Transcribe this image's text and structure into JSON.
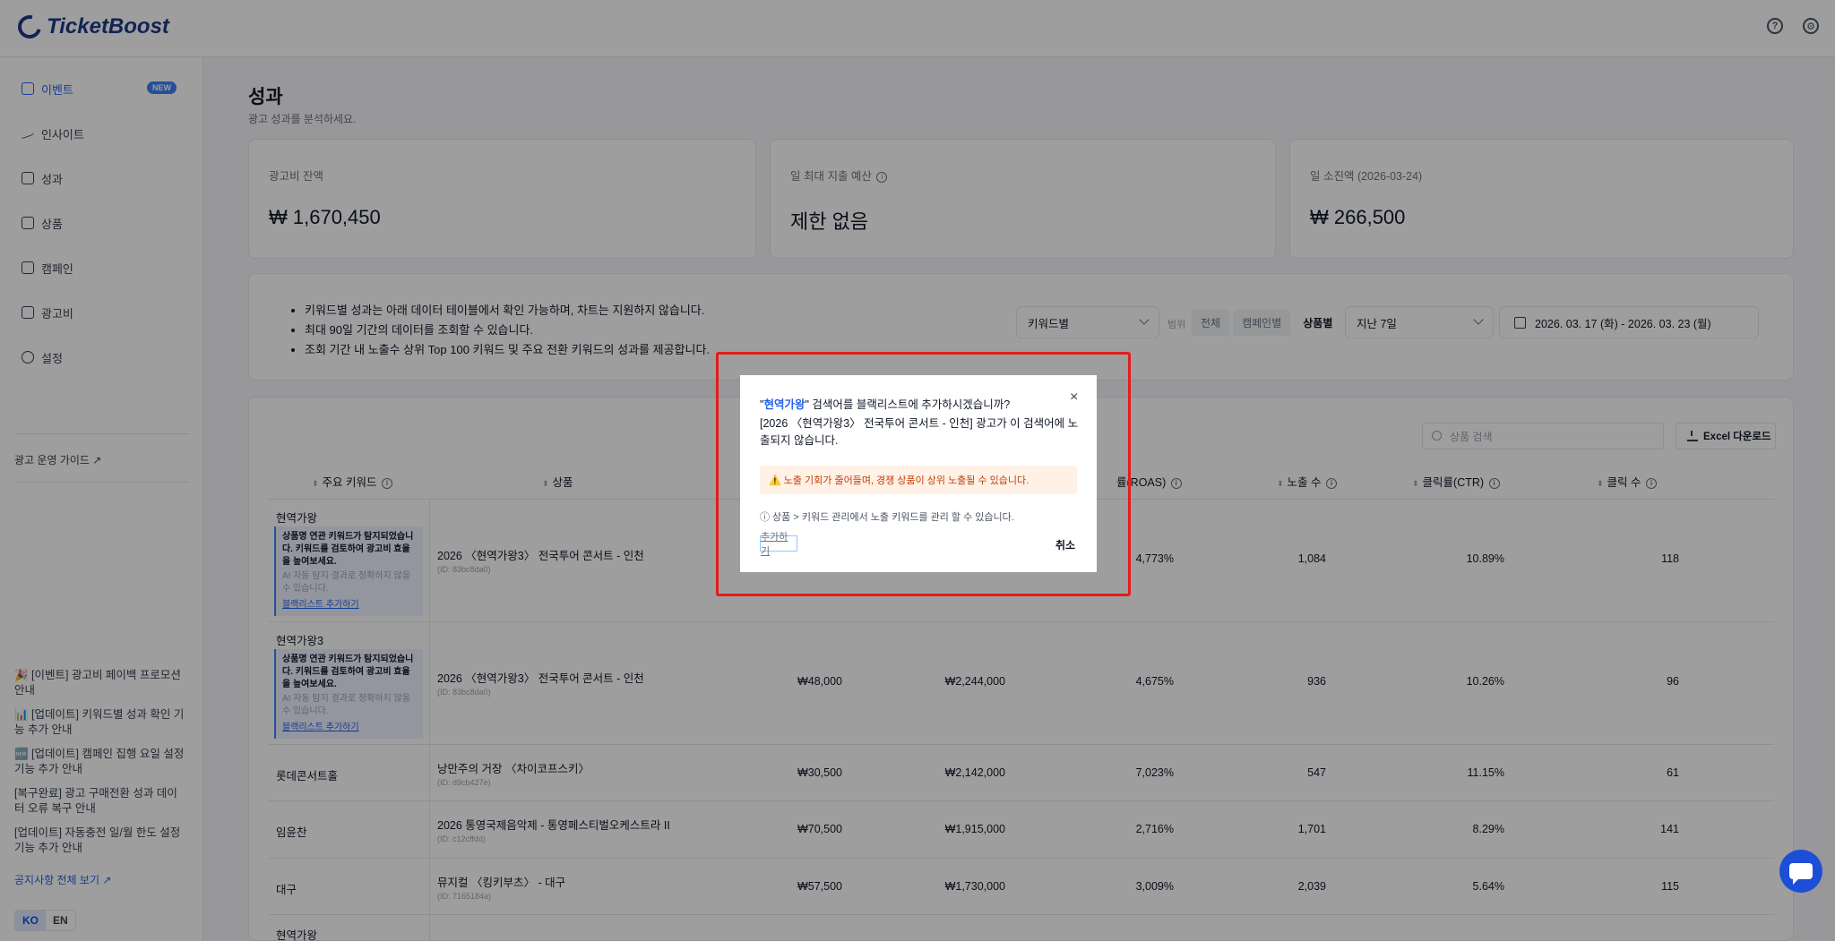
{
  "app": {
    "logo_text": "TicketBoost"
  },
  "sidebar": {
    "items": [
      {
        "label": "이벤트",
        "icon": "gift-icon",
        "badge": "NEW"
      },
      {
        "label": "인사이트",
        "icon": "activity-icon"
      },
      {
        "label": "성과",
        "icon": "bar-chart-icon"
      },
      {
        "label": "상품",
        "icon": "box-icon"
      },
      {
        "label": "캠페인",
        "icon": "grid-icon"
      },
      {
        "label": "광고비",
        "icon": "credit-card-icon"
      },
      {
        "label": "설정",
        "icon": "gear-icon"
      }
    ],
    "guide_link": "광고 운영 가이드 ↗",
    "notices": [
      "🎉 [이벤트] 광고비 페이백 프로모션 안내",
      "📊 [업데이트] 키워드별 성과 확인 기능 추가 안내",
      "🆕 [업데이트] 캠페인 집행 요일 설정 기능 추가 안내",
      "[복구완료] 광고 구매전환 성과 데이터 오류 복구 안내",
      "[업데이트] 자동충전 일/월 한도 설정 기능 추가 안내"
    ],
    "all_notices": "공지사항 전체 보기 ↗",
    "lang": {
      "ko": "KO",
      "en": "EN"
    }
  },
  "page": {
    "title": "성과",
    "subtitle": "광고 성과를 분석하세요."
  },
  "cards": [
    {
      "label": "광고비 잔액",
      "value": "₩ 1,670,450",
      "info": ""
    },
    {
      "label": "일 최대 지출 예산",
      "value": "제한 없음",
      "info": "i"
    },
    {
      "label": "일 소진액 (2026-03-24)",
      "value": "₩ 266,500",
      "info": ""
    }
  ],
  "filters": {
    "bullets": [
      "키워드별 성과는 아래 데이터 테이블에서 확인 가능하며, 차트는 지원하지 않습니다.",
      "최대 90일 기간의 데이터를 조회할 수 있습니다.",
      "조회 기간 내 노출수 상위 Top 100 키워드 및 주요 전환 키워드의 성과를 제공합니다."
    ],
    "view_select": "키워드별",
    "range_label": "범위",
    "segments": [
      "전체",
      "캠페인별",
      "상품별"
    ],
    "period_select": "지난 7일",
    "date_range": "2026. 03. 17 (화) - 2026. 03. 23 (월)"
  },
  "table": {
    "search_placeholder": "상품 검색",
    "excel_label": "Excel 다운로드",
    "headers": {
      "keyword": "주요 키워드",
      "product": "상품",
      "roas": "률(ROAS)",
      "impressions": "노출 수",
      "ctr": "클릭률(CTR)",
      "clicks": "클릭 수"
    },
    "warn": {
      "bold": "상품명 연관 키워드가 탐지되었습니다. 키워드를 검토하여 광고비 효율을 높여보세요.",
      "muted": "AI 자동 탐지 결과로 정확하지 않을 수 있습니다.",
      "link": "블랙리스트 추가하기"
    },
    "rows": [
      {
        "keyword": "현역가왕",
        "product": "2026 〈현역가왕3〉 전국투어 콘서트 - 인천",
        "pid": "(ID: 83bc8da0)",
        "cost": "",
        "revenue": "",
        "roas": "4,773%",
        "impressions": "1,084",
        "ctr": "10.89%",
        "clicks": "118"
      },
      {
        "keyword": "현역가왕3",
        "product": "2026 〈현역가왕3〉 전국투어 콘서트 - 인천",
        "pid": "(ID: 83bc8da0)",
        "cost": "₩48,000",
        "revenue": "₩2,244,000",
        "roas": "4,675%",
        "impressions": "936",
        "ctr": "10.26%",
        "clicks": "96"
      },
      {
        "keyword": "롯데콘서트홀",
        "product": "낭만주의 거장 〈차이코프스키〉",
        "pid": "(ID: d9cb427e)",
        "cost": "₩30,500",
        "revenue": "₩2,142,000",
        "roas": "7,023%",
        "impressions": "547",
        "ctr": "11.15%",
        "clicks": "61"
      },
      {
        "keyword": "임윤찬",
        "product": "2026 통영국제음악제 - 통영페스티벌오케스트라 II",
        "pid": "(ID: c12cffdd)",
        "cost": "₩70,500",
        "revenue": "₩1,915,000",
        "roas": "2,716%",
        "impressions": "1,701",
        "ctr": "8.29%",
        "clicks": "141"
      },
      {
        "keyword": "대구",
        "product": "뮤지컬 〈킹키부츠〉 - 대구",
        "pid": "(ID: 7165184a)",
        "cost": "₩57,500",
        "revenue": "₩1,730,000",
        "roas": "3,009%",
        "impressions": "2,039",
        "ctr": "5.64%",
        "clicks": "115"
      },
      {
        "keyword": "현역가왕"
      }
    ]
  },
  "modal": {
    "title_quote_open": "\"",
    "title_keyword": "현역가왕",
    "title_rest": "\" 검색어를 블랙리스트에 추가하시겠습니까?",
    "description": "[2026 〈현역가왕3〉 전국투어 콘서트 - 인천] 광고가 이 검색어에 노출되지 않습니다.",
    "warning": "⚠️ 노출 기회가 줄어들며, 경쟁 상품이 상위 노출될 수 있습니다.",
    "note": "ⓘ 상품 > 키워드 관리에서 노출 키워드를 관리 할 수 있습니다.",
    "confirm_label": "추가하기",
    "cancel_label": "취소",
    "close_glyph": "×"
  },
  "colors": {
    "accent": "#2563eb",
    "highlight_border": "#e11d1d",
    "warning_bg": "#fff1e6"
  }
}
